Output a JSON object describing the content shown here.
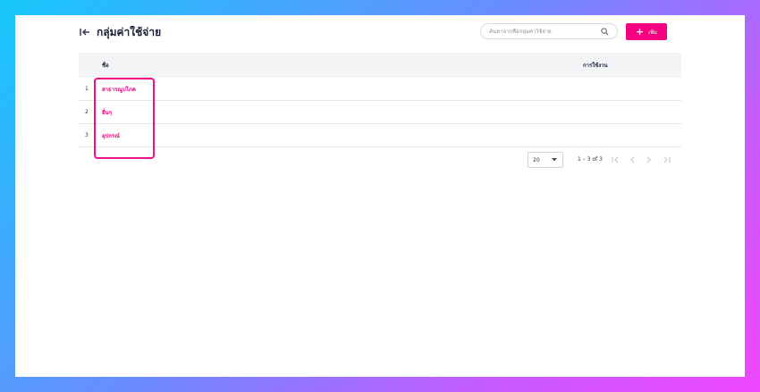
{
  "header": {
    "title": "กลุ่มค่าใช้จ่าย",
    "back_icon": "collapse-left-arrow-icon"
  },
  "search": {
    "placeholder": "ค้นหาจากชื่อกลุ่มค่าใช้จ่าย",
    "value": "",
    "icon": "search-icon"
  },
  "add_button": {
    "label": "เพิ่ม",
    "icon": "plus-icon",
    "color": "#f5007f"
  },
  "table": {
    "columns": [
      "ชื่อ",
      "การใช้งาน"
    ],
    "rows": [
      {
        "index": "1",
        "name": "สาธารณูปโภค",
        "usage": ""
      },
      {
        "index": "2",
        "name": "อื่นๆ",
        "usage": ""
      },
      {
        "index": "3",
        "name": "อุปกรณ์",
        "usage": ""
      }
    ]
  },
  "pagination": {
    "page_size": "20",
    "range_text": "1 – 3 of 3",
    "icons": [
      "first-page-icon",
      "prev-page-icon",
      "next-page-icon",
      "last-page-icon"
    ]
  },
  "colors": {
    "accent": "#f5007f",
    "link": "#e0047a",
    "highlight_border": "#f0118a"
  }
}
